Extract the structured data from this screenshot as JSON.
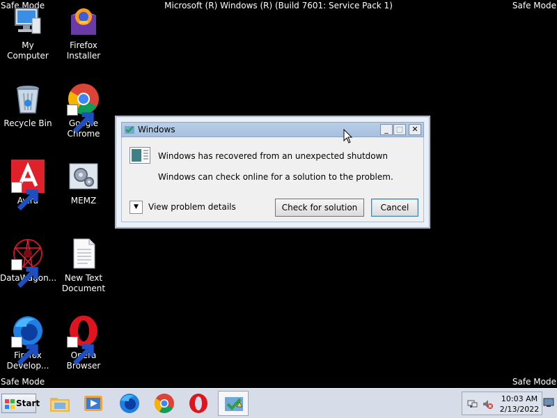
{
  "screen": {
    "safe_mode_label": "Safe Mode",
    "os_build": "Microsoft (R) Windows (R) (Build 7601: Service Pack 1)"
  },
  "desktop": {
    "icons": [
      {
        "label": "My Computer",
        "icon": "computer-icon"
      },
      {
        "label": "Firefox Installer",
        "icon": "firefox-installer-icon"
      },
      {
        "label": "Recycle Bin",
        "icon": "recycle-bin-icon"
      },
      {
        "label": "Google Chrome",
        "icon": "chrome-icon"
      },
      {
        "label": "Avira",
        "icon": "avira-icon"
      },
      {
        "label": "MEMZ",
        "icon": "memz-icon"
      },
      {
        "label": "DataWagon...",
        "icon": "datawagon-icon"
      },
      {
        "label": "New Text Document",
        "icon": "text-document-icon"
      },
      {
        "label": "Firefox Develop...",
        "icon": "firefox-developer-icon"
      },
      {
        "label": "Opera Browser",
        "icon": "opera-icon"
      }
    ]
  },
  "dialog": {
    "title": "Windows",
    "heading": "Windows has recovered from an unexpected shutdown",
    "message": "Windows can check online for a solution to the problem.",
    "details_label": "View problem details",
    "check_button": "Check for solution",
    "cancel_button": "Cancel",
    "minimize_glyph": "_",
    "maximize_glyph": "□",
    "close_glyph": "✕",
    "details_glyph": "▼"
  },
  "taskbar": {
    "start_label": "Start",
    "pinned": [
      "explorer-icon",
      "media-player-icon",
      "firefox-icon",
      "chrome-icon",
      "opera-icon",
      "action-center-icon"
    ],
    "time": "10:03 AM",
    "date": "2/13/2022"
  }
}
